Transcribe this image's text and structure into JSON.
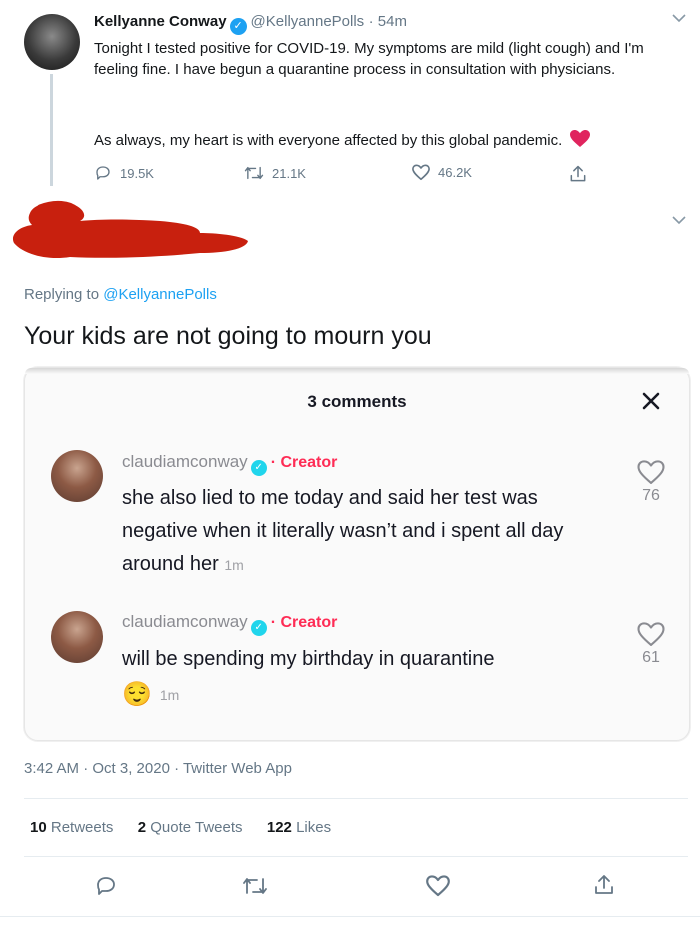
{
  "tweet": {
    "author_name": "Kellyanne Conway",
    "handle": "@KellyannePolls",
    "time": "· 54m",
    "text_p1": "Tonight I tested positive for COVID-19. My symptoms are mild (light cough) and I'm feeling fine. I have begun a quarantine process in consultation with physicians.",
    "text_p2": "As always, my heart is with everyone affected by this global pandemic.",
    "replies": "19.5K",
    "retweets": "21.1K",
    "likes": "46.2K"
  },
  "reply": {
    "replying_prefix": "Replying to",
    "replying_handle": "@KellyannePolls",
    "text": "Your kids are not going to mourn you",
    "timestamp": "3:42 AM · Oct 3, 2020 · Twitter Web App",
    "retweets_count": "10",
    "retweets_label": "Retweets",
    "quotes_count": "2",
    "quotes_label": "Quote Tweets",
    "likes_count": "122",
    "likes_label": "Likes"
  },
  "tiktok": {
    "header": "3 comments",
    "close": "×",
    "comments": [
      {
        "username": "claudiamconway",
        "badge": "· Creator",
        "text": "she also lied to me today and said her test was negative when it literally wasn’t and i spent all day around her",
        "time": "1m",
        "likes": "76"
      },
      {
        "username": "claudiamconway",
        "badge": "· Creator",
        "text": "will be spending my birthday in quarantine",
        "emoji": "😌",
        "time": "1m",
        "likes": "61"
      }
    ]
  },
  "colors": {
    "twitter_blue": "#1da1f2",
    "heart_red": "#e0245e",
    "creator_pink": "#fe2c55",
    "redaction_red": "#c8200e"
  }
}
